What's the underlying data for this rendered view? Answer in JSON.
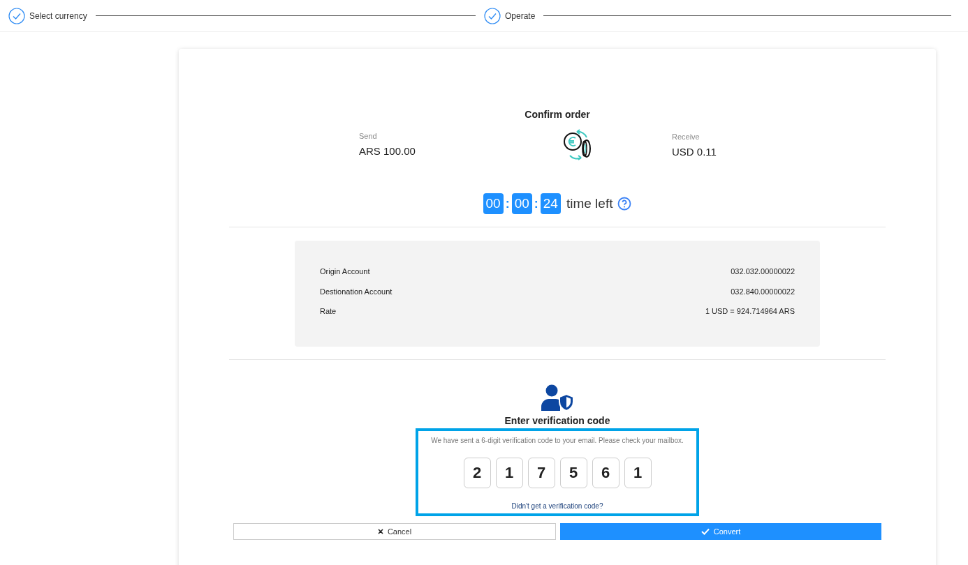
{
  "stepper": [
    {
      "label": "Select currency",
      "done": true
    },
    {
      "label": "Operate",
      "done": true
    }
  ],
  "order": {
    "title": "Confirm order",
    "send": {
      "label": "Send",
      "amount": "ARS 100.00"
    },
    "receive": {
      "label": "Receive",
      "amount": "USD 0.11"
    }
  },
  "timer": {
    "parts": [
      "00",
      "00",
      "24"
    ],
    "separator": ":",
    "label": "time left"
  },
  "details": [
    {
      "label": "Origin Account",
      "value": "032.032.00000022"
    },
    {
      "label": "Destionation Account",
      "value": "032.840.00000022"
    },
    {
      "label": "Rate",
      "value": "1 USD = 924.714964 ARS"
    }
  ],
  "verification": {
    "title": "Enter verification code",
    "message": "We have sent a 6-digit verification code to your email. Please check your mailbox.",
    "digits": [
      "2",
      "1",
      "7",
      "5",
      "6",
      "1"
    ],
    "resend_link": "Didn't get a verification code?",
    "highlighted": true
  },
  "buttons": [
    {
      "label": "Cancel",
      "kind": "cancel"
    },
    {
      "label": "Convert",
      "kind": "confirm"
    }
  ]
}
